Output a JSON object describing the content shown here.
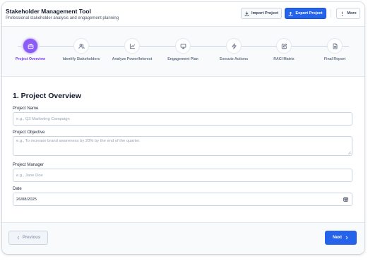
{
  "header": {
    "title": "Stakeholder Management Tool",
    "subtitle": "Professional stakeholder analysis and engagement planning",
    "import_label": "Import Project",
    "export_label": "Export Project",
    "more_label": "More"
  },
  "stepper": {
    "active_index": 0,
    "steps": [
      {
        "label": "Project Overview",
        "icon": "briefcase-icon"
      },
      {
        "label": "Identify Stakeholders",
        "icon": "users-icon"
      },
      {
        "label": "Analyze Power/Interest",
        "icon": "chart-icon"
      },
      {
        "label": "Engagement Plan",
        "icon": "monitor-icon"
      },
      {
        "label": "Execute Actions",
        "icon": "lightning-icon"
      },
      {
        "label": "RACI Matrix",
        "icon": "edit-icon"
      },
      {
        "label": "Final Report",
        "icon": "document-icon"
      }
    ]
  },
  "form": {
    "section_title": "1. Project Overview",
    "project_name": {
      "label": "Project Name",
      "placeholder": "e.g., Q3 Marketing Campaign",
      "value": ""
    },
    "project_objective": {
      "label": "Project Objective",
      "placeholder": "e.g., To increase brand awareness by 20% by the end of the quarter.",
      "value": ""
    },
    "project_manager": {
      "label": "Project Manager",
      "placeholder": "e.g., Jane Doe",
      "value": ""
    },
    "date": {
      "label": "Date",
      "value": "26/08/2025"
    }
  },
  "footer": {
    "previous_label": "Previous",
    "next_label": "Next"
  },
  "colors": {
    "primary": "#2563eb",
    "active_step": "#8b5cf6",
    "muted": "#94a3b8"
  }
}
